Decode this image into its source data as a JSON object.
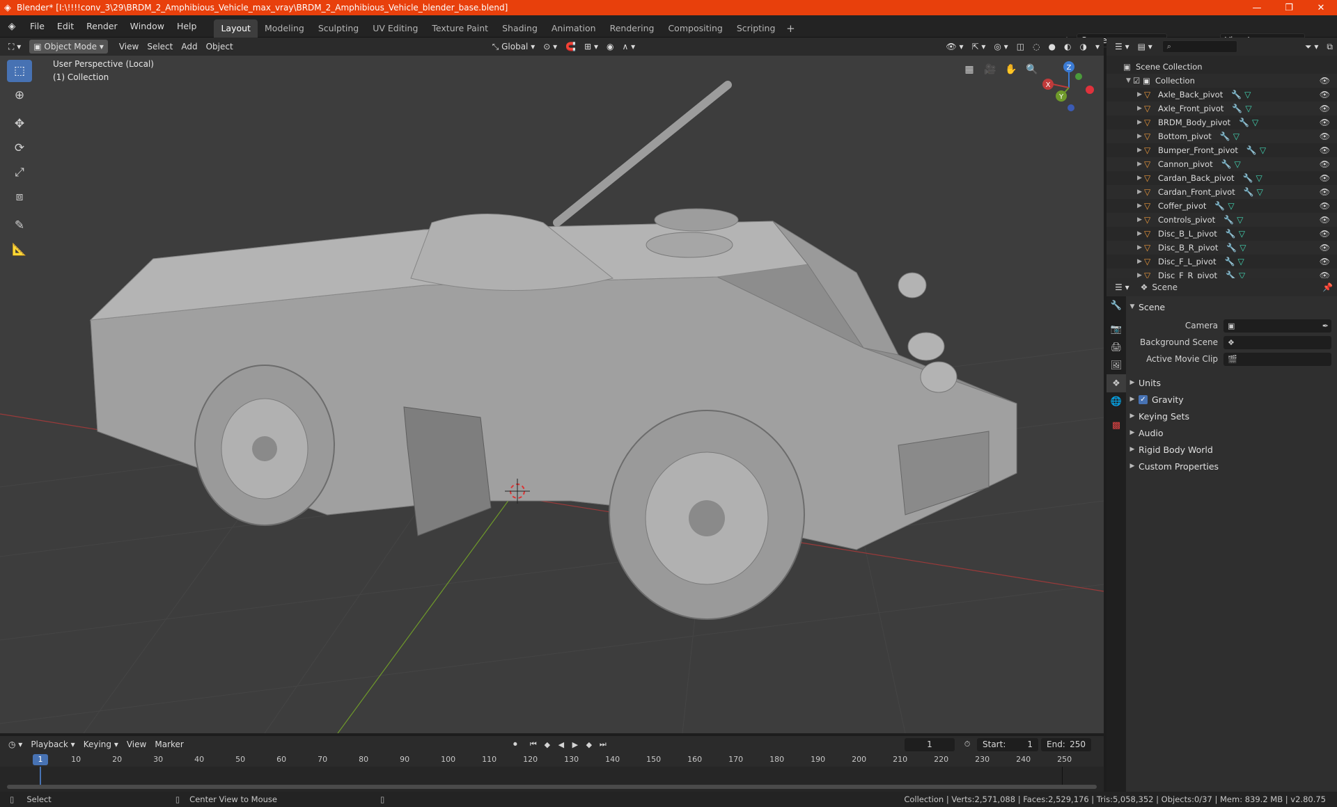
{
  "window": {
    "title": "Blender* [I:\\!!!!conv_3\\29\\BRDM_2_Amphibious_Vehicle_max_vray\\BRDM_2_Amphibious_Vehicle_blender_base.blend]",
    "minimize": "—",
    "maximize": "❐",
    "close": "✕"
  },
  "menu": {
    "items": [
      "File",
      "Edit",
      "Render",
      "Window",
      "Help"
    ]
  },
  "workspaces": [
    "Layout",
    "Modeling",
    "Sculpting",
    "UV Editing",
    "Texture Paint",
    "Shading",
    "Animation",
    "Rendering",
    "Compositing",
    "Scripting"
  ],
  "workspace_add": "+",
  "scene_selector": {
    "value": "Scene"
  },
  "view_layer": {
    "value": "View Layer"
  },
  "viewport_header": {
    "mode": "Object Mode",
    "menus": [
      "View",
      "Select",
      "Add",
      "Object"
    ],
    "orientation": "Global"
  },
  "viewport": {
    "perspective_label": "User Perspective (Local)",
    "collection_label": "(1) Collection",
    "gizmo": {
      "x": "X",
      "y": "Y",
      "z": "Z"
    }
  },
  "outliner": {
    "search_placeholder": "",
    "scene_collection": "Scene Collection",
    "collection": "Collection",
    "objects": [
      "Axle_Back_pivot",
      "Axle_Front_pivot",
      "BRDM_Body_pivot",
      "Bottom_pivot",
      "Bumper_Front_pivot",
      "Cannon_pivot",
      "Cardan_Back_pivot",
      "Cardan_Front_pivot",
      "Coffer_pivot",
      "Controls_pivot",
      "Disc_B_L_pivot",
      "Disc_B_R_pivot",
      "Disc_F_L_pivot",
      "Disc_F_R_pivot"
    ]
  },
  "properties": {
    "context": "Scene",
    "scene_panel": "Scene",
    "camera_label": "Camera",
    "background_scene_label": "Background Scene",
    "active_movie_clip_label": "Active Movie Clip",
    "panels": [
      "Units",
      "Gravity",
      "Keying Sets",
      "Audio",
      "Rigid Body World",
      "Custom Properties"
    ],
    "gravity_checked": true
  },
  "timeline": {
    "menus": [
      "Playback",
      "Keying",
      "View",
      "Marker"
    ],
    "current_frame": "1",
    "start_label": "Start:",
    "start": "1",
    "end_label": "End:",
    "end": "250",
    "ruler_current": "1",
    "ruler": [
      "10",
      "20",
      "30",
      "40",
      "50",
      "60",
      "70",
      "80",
      "90",
      "100",
      "110",
      "120",
      "130",
      "140",
      "150",
      "160",
      "170",
      "180",
      "190",
      "200",
      "210",
      "220",
      "230",
      "240",
      "250"
    ]
  },
  "status": {
    "select": "Select",
    "center_view": "Center View to Mouse",
    "stats": "Collection | Verts:2,571,088 | Faces:2,529,176 | Tris:5,058,352 | Objects:0/37 | Mem: 839.2 MB | v2.80.75"
  },
  "colors": {
    "title_bar": "#e8400c",
    "active_blue": "#4772b3",
    "object_orange": "#e8973c",
    "mesh_teal": "#43d6b4",
    "axis_red": "#c03b3b",
    "axis_green": "#6f9a2a"
  }
}
